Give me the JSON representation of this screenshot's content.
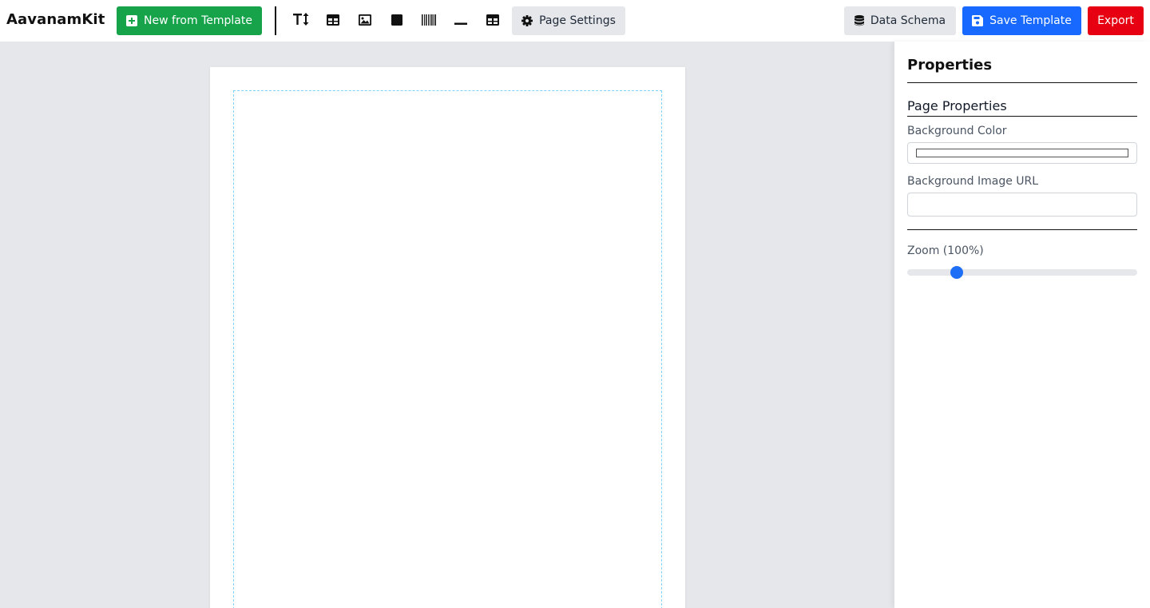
{
  "app": {
    "brand": "AavanamKit"
  },
  "toolbar": {
    "new_from_template_label": "New from Template",
    "tools": [
      {
        "name": "text-tool",
        "icon": "text-height-icon"
      },
      {
        "name": "table-tool",
        "icon": "table-icon"
      },
      {
        "name": "image-tool",
        "icon": "image-icon"
      },
      {
        "name": "rectangle-tool",
        "icon": "square-icon"
      },
      {
        "name": "barcode-tool",
        "icon": "barcode-icon"
      },
      {
        "name": "line-tool",
        "icon": "horizontal-line-icon"
      },
      {
        "name": "layout-tool",
        "icon": "table-icon"
      }
    ],
    "page_settings_label": "Page Settings",
    "data_schema_label": "Data Schema",
    "save_template_label": "Save Template",
    "export_label": "Export"
  },
  "panel": {
    "title": "Properties",
    "section_title": "Page Properties",
    "background_color_label": "Background Color",
    "background_color_value": "#ffffff",
    "background_image_label": "Background Image URL",
    "background_image_value": "",
    "zoom_label": "Zoom (100%)",
    "zoom_fraction": 0.2
  },
  "colors": {
    "green_button": "#16a34a",
    "blue_button": "#1769ff",
    "red_button": "#e60012",
    "gray_button": "#e5e7eb",
    "workspace_bg": "#e5e7eb",
    "margin_guide": "#7dd3fc",
    "slider_thumb": "#1e6ff5"
  }
}
